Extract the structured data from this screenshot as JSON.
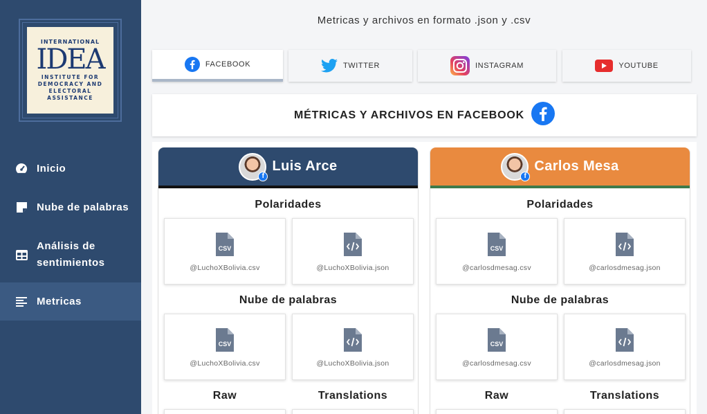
{
  "logo": {
    "line1": "INTERNATIONAL",
    "line2": "IDEA",
    "line3a": "INSTITUTE FOR",
    "line3b": "DEMOCRACY AND",
    "line3c": "ELECTORAL",
    "line3d": "ASSISTANCE"
  },
  "sidebar": {
    "items": [
      {
        "label": "Inicio",
        "icon": "dashboard-icon"
      },
      {
        "label": "Nube de palabras",
        "icon": "note-icon"
      },
      {
        "label": "Análisis de sentimientos",
        "icon": "table-icon"
      },
      {
        "label": "Metricas",
        "icon": "list-icon",
        "active": true
      }
    ]
  },
  "page": {
    "title": "Metricas y archivos en formato .json y .csv"
  },
  "tabs": [
    {
      "label": "FACEBOOK",
      "icon": "facebook-icon",
      "active": true
    },
    {
      "label": "TWITTER",
      "icon": "twitter-icon"
    },
    {
      "label": "INSTAGRAM",
      "icon": "instagram-icon"
    },
    {
      "label": "YOUTUBE",
      "icon": "youtube-icon"
    }
  ],
  "header": {
    "title": "MÉTRICAS Y ARCHIVOS EN FACEBOOK"
  },
  "sections": {
    "polaridades": "Polaridades",
    "nube": "Nube de palabras",
    "raw": "Raw",
    "translations": "Translations"
  },
  "candidates": [
    {
      "name": "Luis Arce",
      "color": "#2e4a6e",
      "stripe": "#111111",
      "csv": "@LuchoXBolivia.csv",
      "json": "@LuchoXBolivia.json"
    },
    {
      "name": "Carlos Mesa",
      "color": "#e98a3f",
      "stripe": "#3f7a4a",
      "csv": "@carlosdmesag.csv",
      "json": "@carlosdmesag.json"
    }
  ],
  "colors": {
    "sidebar": "#2e4a6e",
    "facebook": "#1877f2",
    "twitter": "#1da1f2",
    "youtube": "#e62d2d",
    "file_icon": "#6b7a90"
  }
}
